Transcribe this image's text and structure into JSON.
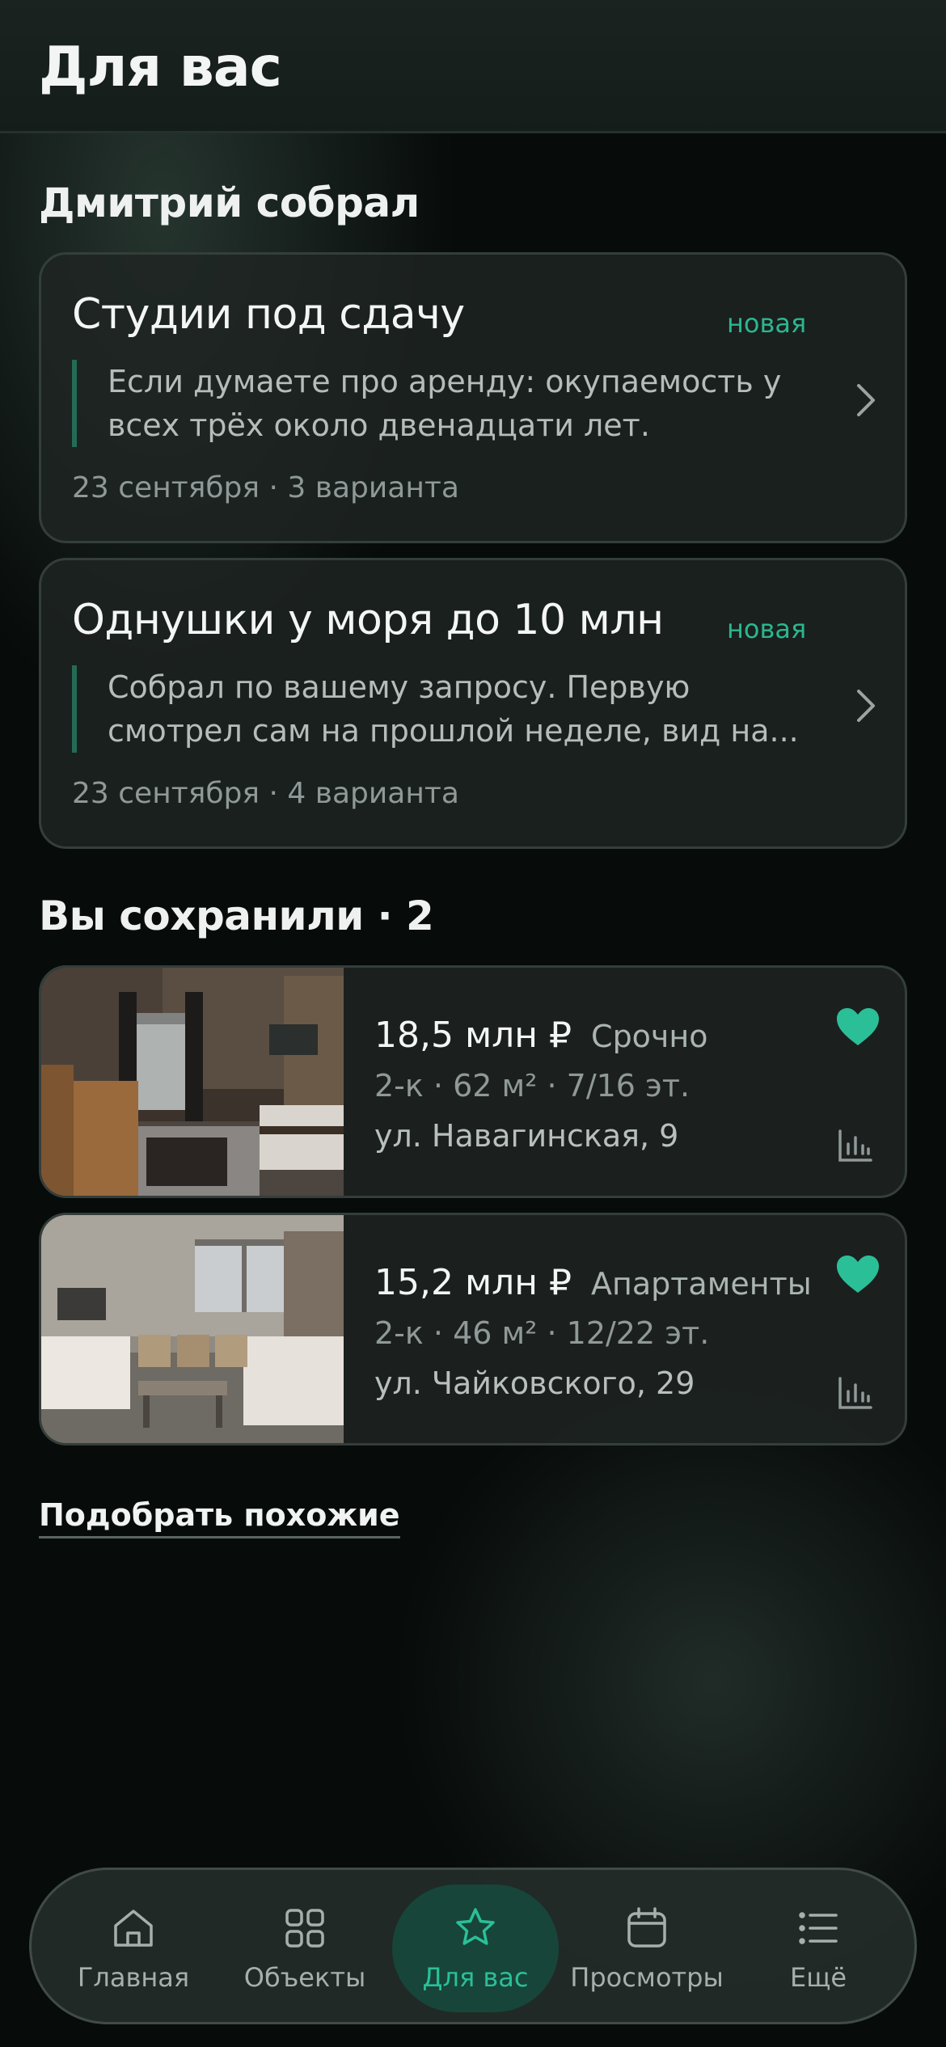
{
  "header": {
    "title": "Для вас"
  },
  "agent_section": {
    "title": "Дмитрий собрал",
    "collections": [
      {
        "title": "Студии под сдачу",
        "badge": "новая",
        "message_line1": "Если думаете про аренду: окупаемость у",
        "message_line2": "всех трёх около двенадцати лет.",
        "meta": "23 сентября · 3 варианта"
      },
      {
        "title": "Однушки у моря до 10 млн",
        "badge": "новая",
        "message_line1": "Собрал по вашему запросу. Первую",
        "message_line2": "смотрел сам на прошлой неделе, вид на...",
        "meta": "23 сентября · 4 варианта"
      }
    ]
  },
  "saved_section": {
    "title": "Вы сохранили · 2",
    "listings": [
      {
        "price": "18,5 млн ₽",
        "tag": "Срочно",
        "specs": "2-к · 62 м² · 7/16 эт.",
        "address": "ул. Навагинская, 9"
      },
      {
        "price": "15,2 млн ₽",
        "tag": "Апартаменты",
        "specs": "2-к · 46 м² · 12/22 эт.",
        "address": "ул. Чайковского, 29"
      }
    ]
  },
  "similar_link": "Подобрать похожие",
  "tabbar": {
    "tabs": [
      {
        "label": "Главная",
        "icon": "home-icon"
      },
      {
        "label": "Объекты",
        "icon": "grid-icon"
      },
      {
        "label": "Для вас",
        "icon": "star-icon",
        "active": true
      },
      {
        "label": "Просмотры",
        "icon": "calendar-icon"
      },
      {
        "label": "Ещё",
        "icon": "menu-list-icon"
      }
    ]
  },
  "colors": {
    "accent": "#2bbf98",
    "background": "#070b0a",
    "card": "#1e2422"
  }
}
